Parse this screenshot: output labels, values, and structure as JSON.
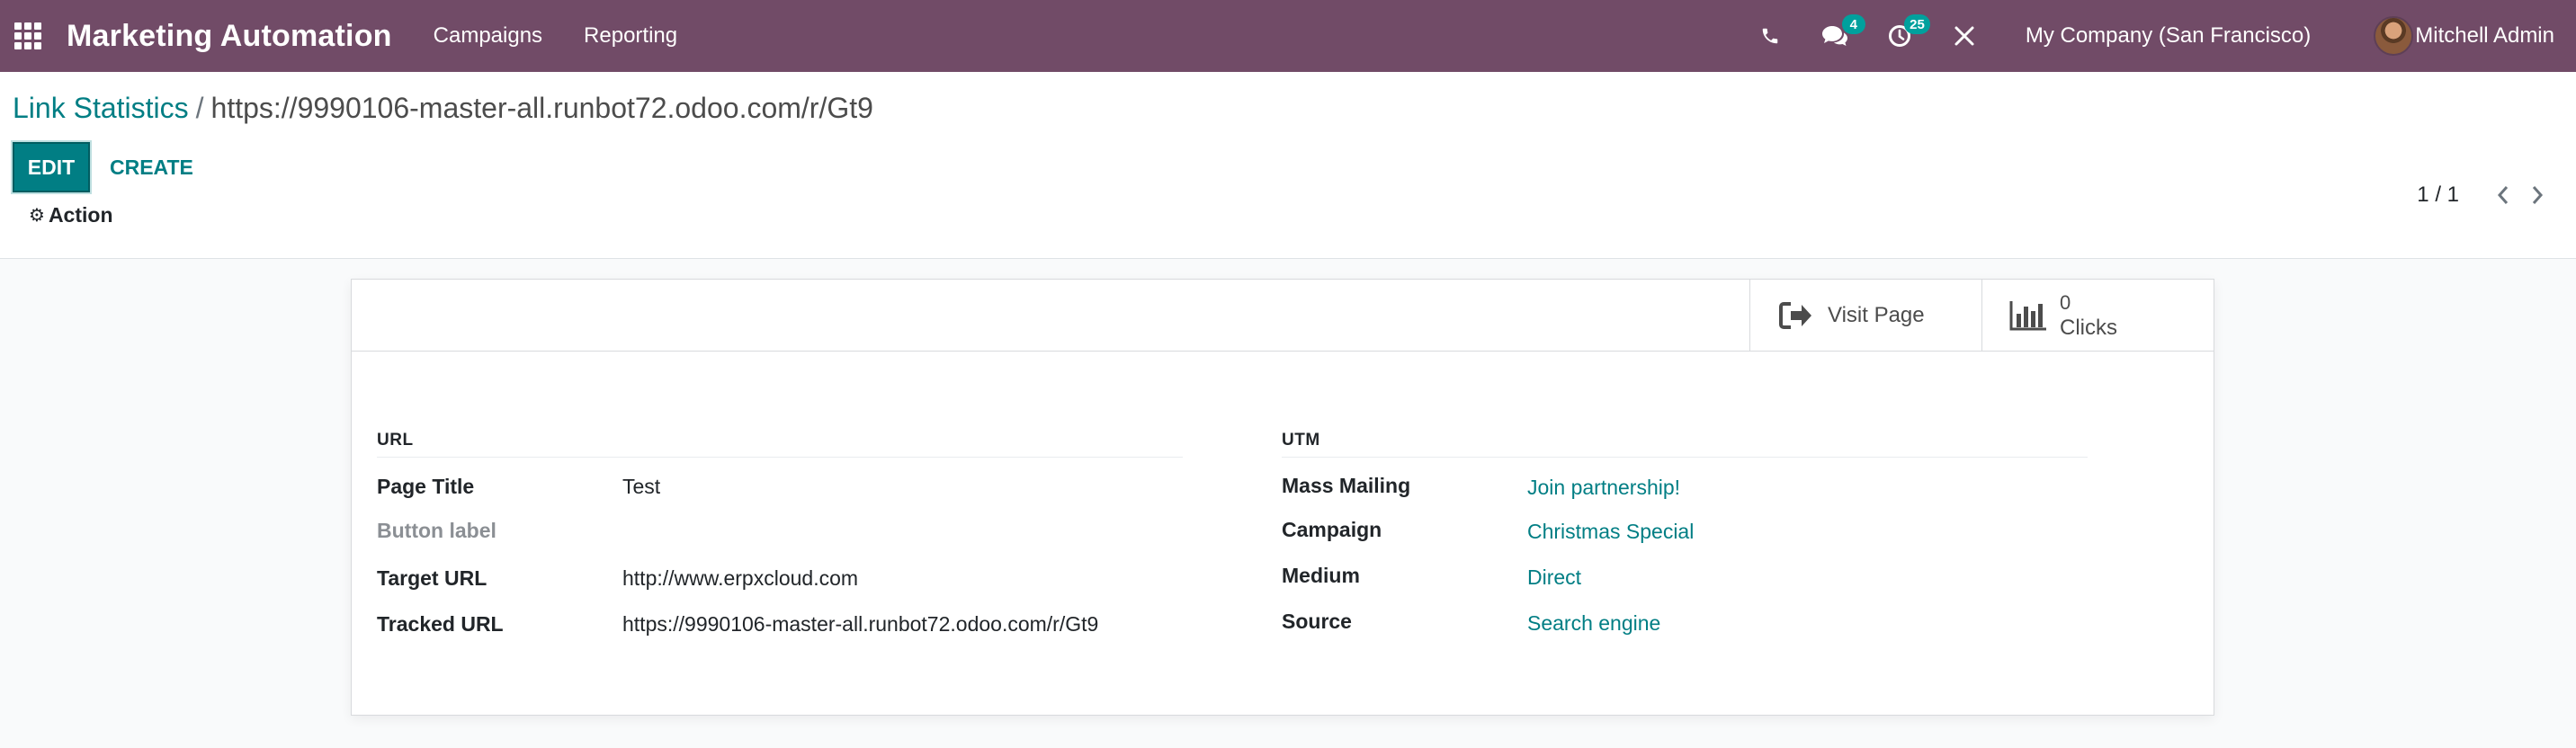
{
  "navbar": {
    "app_title": "Marketing Automation",
    "menu": [
      "Campaigns",
      "Reporting"
    ],
    "messages_count": "4",
    "activities_count": "25",
    "company": "My Company (San Francisco)",
    "user": "Mitchell Admin",
    "colors": {
      "bar": "#714b67",
      "badge": "#00a09d"
    }
  },
  "breadcrumb": {
    "parent": "Link Statistics",
    "separator": "/",
    "current": "https://9990106-master-all.runbot72.odoo.com/r/Gt9"
  },
  "buttons": {
    "edit": "EDIT",
    "create": "CREATE",
    "action": "Action"
  },
  "pager": {
    "value": "1 / 1"
  },
  "stat_buttons": {
    "visit_label": "Visit Page",
    "clicks_value": "0",
    "clicks_label": "Clicks"
  },
  "url_group": {
    "title": "URL",
    "fields": [
      {
        "label": "Page Title",
        "value": "Test"
      },
      {
        "label": "Button label",
        "value": ""
      },
      {
        "label": "Target URL",
        "value": "http://www.erpxcloud.com"
      },
      {
        "label": "Tracked URL",
        "value": "https://9990106-master-all.runbot72.odoo.com/r/Gt9"
      }
    ]
  },
  "utm_group": {
    "title": "UTM",
    "fields": [
      {
        "label": "Mass Mailing",
        "value": "Join partnership!"
      },
      {
        "label": "Campaign",
        "value": "Christmas Special"
      },
      {
        "label": "Medium",
        "value": "Direct"
      },
      {
        "label": "Source",
        "value": "Search engine"
      }
    ]
  },
  "icons": [
    "apps-grid-icon",
    "phone-icon",
    "chat-icon",
    "clock-icon",
    "tools-icon",
    "gear-icon",
    "chevron-left-icon",
    "chevron-right-icon",
    "sign-out-icon",
    "bar-chart-icon"
  ],
  "accent_color": "#017e84"
}
